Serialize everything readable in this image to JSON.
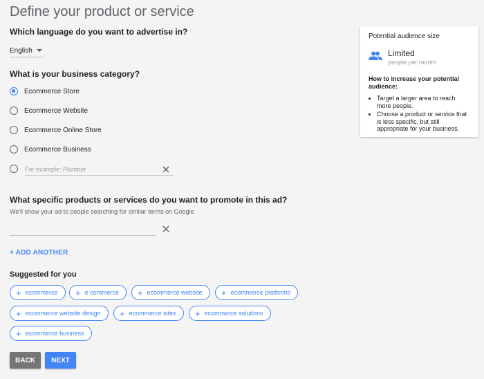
{
  "page_title": "Define your product or service",
  "language": {
    "question": "Which language do you want to advertise in?",
    "selected": "English"
  },
  "category": {
    "question": "What is your business category?",
    "options": [
      {
        "label": "Ecommerce Store",
        "checked": true
      },
      {
        "label": "Ecommerce Website",
        "checked": false
      },
      {
        "label": "Ecommerce Online Store",
        "checked": false
      },
      {
        "label": "Ecommerce Business",
        "checked": false
      }
    ],
    "other_placeholder": "For example: Plumber"
  },
  "products": {
    "question": "What specific products or services do you want to promote in this ad?",
    "subtitle": "We'll show your ad to people searching for similar terms on Google",
    "input_value": "",
    "add_another": "+ ADD ANOTHER"
  },
  "suggested": {
    "heading": "Suggested for you",
    "chips": [
      "ecommerce",
      "e commerce",
      "ecommerce website",
      "ecommerce platforms",
      "ecommerce website design",
      "ecommerce sites",
      "ecommerce solutions",
      "ecommerce business"
    ]
  },
  "buttons": {
    "back": "BACK",
    "next": "NEXT"
  },
  "audience_card": {
    "title": "Potential audience size",
    "icon": "people-icon",
    "level": "Limited",
    "unit": "people per month",
    "how_title": "How to increase your potential audience:",
    "tips": [
      "Target a larger area to reach more people.",
      "Choose a product or service that is less specific, but still appropriate for your business."
    ]
  },
  "colors": {
    "accent": "#4285f4",
    "back_button": "#757575",
    "background": "#f4f4f4"
  }
}
